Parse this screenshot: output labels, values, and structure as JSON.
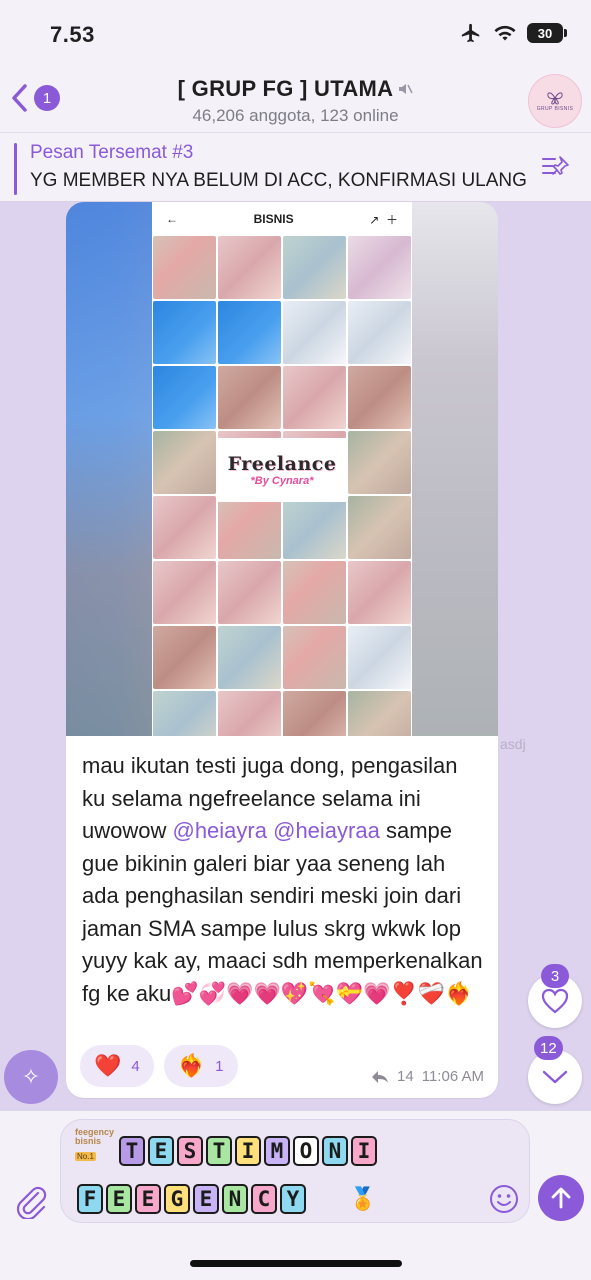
{
  "status": {
    "time": "7.53",
    "battery": "30"
  },
  "header": {
    "back_count": "1",
    "title": "[ GRUP FG ] UTAMA",
    "subtitle": "46,206 anggota, 123 online",
    "avatar_text": "GRUP BISNIS"
  },
  "pinned": {
    "label": "Pesan Tersemat #3",
    "text": "YG MEMBER NYA BELUM DI ACC, KONFIRMASI ULANG"
  },
  "media": {
    "app_title": "BISNIS",
    "freelance_title": "Freelance",
    "freelance_sub": "*By Cynara*"
  },
  "message": {
    "part1": "mau ikutan testi juga dong, pengasilan ku selama ngefreelance selama ini uwowow ",
    "mention1": "@heiayra",
    "part2": " ",
    "mention2": "@heiayraa",
    "part3": " sampe gue bikinin galeri biar yaa seneng lah ada penghasilan sendiri meski join dari jaman SMA sampe lulus skrg wkwk lop yuyy kak ay, maaci sdh memperkenalkan fg ke aku",
    "emojis": "💕💞💗💗💖💘💝💗❣️❤️‍🩹❤️‍🔥",
    "reactions": [
      {
        "emoji": "❤️",
        "count": "4"
      },
      {
        "emoji": "❤️‍🔥",
        "count": "1"
      }
    ],
    "forwards": "14",
    "time": "11:06 AM"
  },
  "ghost_text": "asdj",
  "float": {
    "reactions_badge": "3",
    "unread_badge": "12"
  },
  "input": {
    "sticker_brand": "feegency bisnis",
    "sticker_tag": "No.1",
    "line1": [
      "T",
      "E",
      "S",
      "T",
      "I",
      "M",
      "O",
      "N",
      "I"
    ],
    "line2": [
      "F",
      "E",
      "E",
      "G",
      "E",
      "N",
      "C",
      "Y"
    ],
    "line1_colors": [
      "#b89be6",
      "#8fd9f0",
      "#f7a7c9",
      "#a8e6a1",
      "#ffe07a",
      "#c7b3f5",
      "#ffffff",
      "#8fd9f0",
      "#f7a7c9"
    ],
    "line2_colors": [
      "#8fd9f0",
      "#a8e6a1",
      "#f7a7c9",
      "#ffe07a",
      "#c7b3f5",
      "#a8e6a1",
      "#f7a7c9",
      "#8fd9f0"
    ]
  },
  "colors": {
    "accent": "#8a5ad8",
    "chat_bg": "#ddd3ef"
  }
}
